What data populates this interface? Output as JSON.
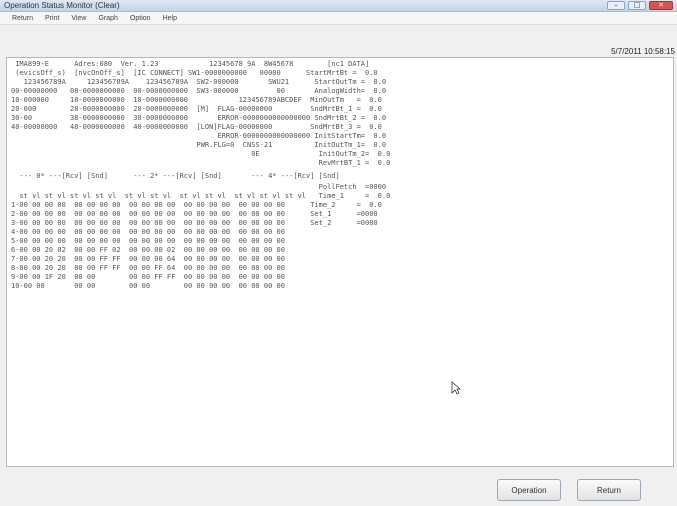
{
  "window": {
    "title": "Operation Status Monitor (Clear)",
    "controls": [
      "–",
      "□",
      "✕"
    ]
  },
  "menu": [
    "Return",
    "Print",
    "View",
    "Graph",
    "Option",
    "Help"
  ],
  "datetime": "5/7/2011 10:58:15",
  "monitor": {
    "lines": [
      " IMA899-E      Adres:080  Ver. 1.23            12345678 9A  8W45678        [nc1 DATA]",
      " (evicsOff_s)  [nvcOnOff_s]  [IC CONNECT] SW1-0000000000   00000      StartMrtBt =  0.0",
      "   123456789A     123456789A    123456789A  SW2-000000       SWU21      StartOutTm =  0.0",
      "00-00000000   08-0000000000  00-0000000000  SW3-000000         00       AnalogWidth=  0.0",
      "10-000000     18-0000000000  10-0000000000            123456789ABCDEF  MinOutTm   =  0.0",
      "20-000        28-0000000000  20-0000000000  [M]  FLAG-00000000         SndMrtBt_1 =  0.0",
      "30-00         38-0000000000  30-0000000000       ERROR-0000000000000000 SndMrtBt_2 =  0.0",
      "40-00000000   48-0000000000  40-0000000000  [LON]FLAG-00000000         SndMrtBt_3 =  0.0",
      "                                                 ERROR-0000000000000000 InitStartTm=  0.0",
      "                                            PWR.FLG=0  CNSS-21          InitOutTm_1=  0.0",
      "                                                         0E              InitOutTm_2=  0.0",
      "                                                                         RevMrtBT_1 =  0.0",
      "  --- 0* ---[Rcv] [Snd]      --- 2* ---[Rcv] [Snd]       --- 4* ---[Rcv] [Snd]",
      "                                                                         PollFetch  =0000",
      "  st vl st vl st vl st vl  st vl st vl  st vl st vl  st vl st vl st vl   Time_1     =  0.0",
      "1-00 00 00 00  00 00 00 00  00 00 00 00  00 00 00 00  00 00 00 00      Time_2     =  0.0",
      "2-00 00 00 00  00 00 00 00  00 00 00 00  00 00 00 00  00 00 00 00      Set_1      =0000",
      "3-00 00 00 00  00 00 00 00  00 00 00 00  00 00 00 00  00 00 00 00      Set_2      =0000",
      "4-00 00 00 00  00 00 00 00  00 00 00 00  00 00 00 00  00 00 00 00",
      "5-00 00 00 00  00 00 00 00  00 00 00 00  00 00 00 00  00 00 00 00",
      "6-00 00 20 02  00 00 FF 02  00 00 00 02  00 00 00 00  00 00 00 00",
      "7-00 00 20 20  00 00 FF FF  00 00 00 64  00 00 00 00  00 00 00 00",
      "8-00 00 20 20  00 00 FF FF  00 00 FF 64  00 00 00 00  00 00 00 00",
      "9-00 00 1F 20  00 00        00 00 FF FF  00 00 00 00  00 00 00 00",
      "10-00 00       00 00        00 00        00 00 00 00  00 00 00 00"
    ]
  },
  "buttons": {
    "operation": "Operation",
    "return": "Return"
  }
}
